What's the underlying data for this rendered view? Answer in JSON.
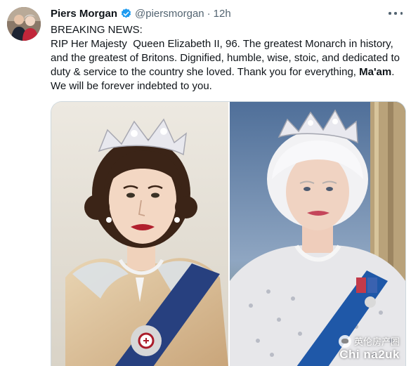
{
  "author": {
    "name": "Piers Morgan",
    "handle": "@piersmorgan",
    "separator": "·",
    "time": "12h"
  },
  "tweet": {
    "lines": [
      "BREAKING NEWS:",
      "RIP Her Majesty  Queen Elizabeth II, 96. The greatest Monarch in history,",
      "and the greatest of Britons. Dignified, humble, wise, stoic, and dedicated to",
      "duty & service to the country she loved. Thank you for everything, ",
      "We will be forever indebted to you."
    ],
    "bold_word": "Ma'am",
    "bold_suffix": "."
  },
  "icons": {
    "verified": "verified-badge-icon",
    "more": "more-options-icon"
  },
  "colors": {
    "verified_blue": "#1d9bf0",
    "secondary_text": "#536471",
    "primary_text": "#0f1419"
  },
  "watermark": {
    "top": "英伦房产圈",
    "bottom": "Chi na2uk"
  }
}
